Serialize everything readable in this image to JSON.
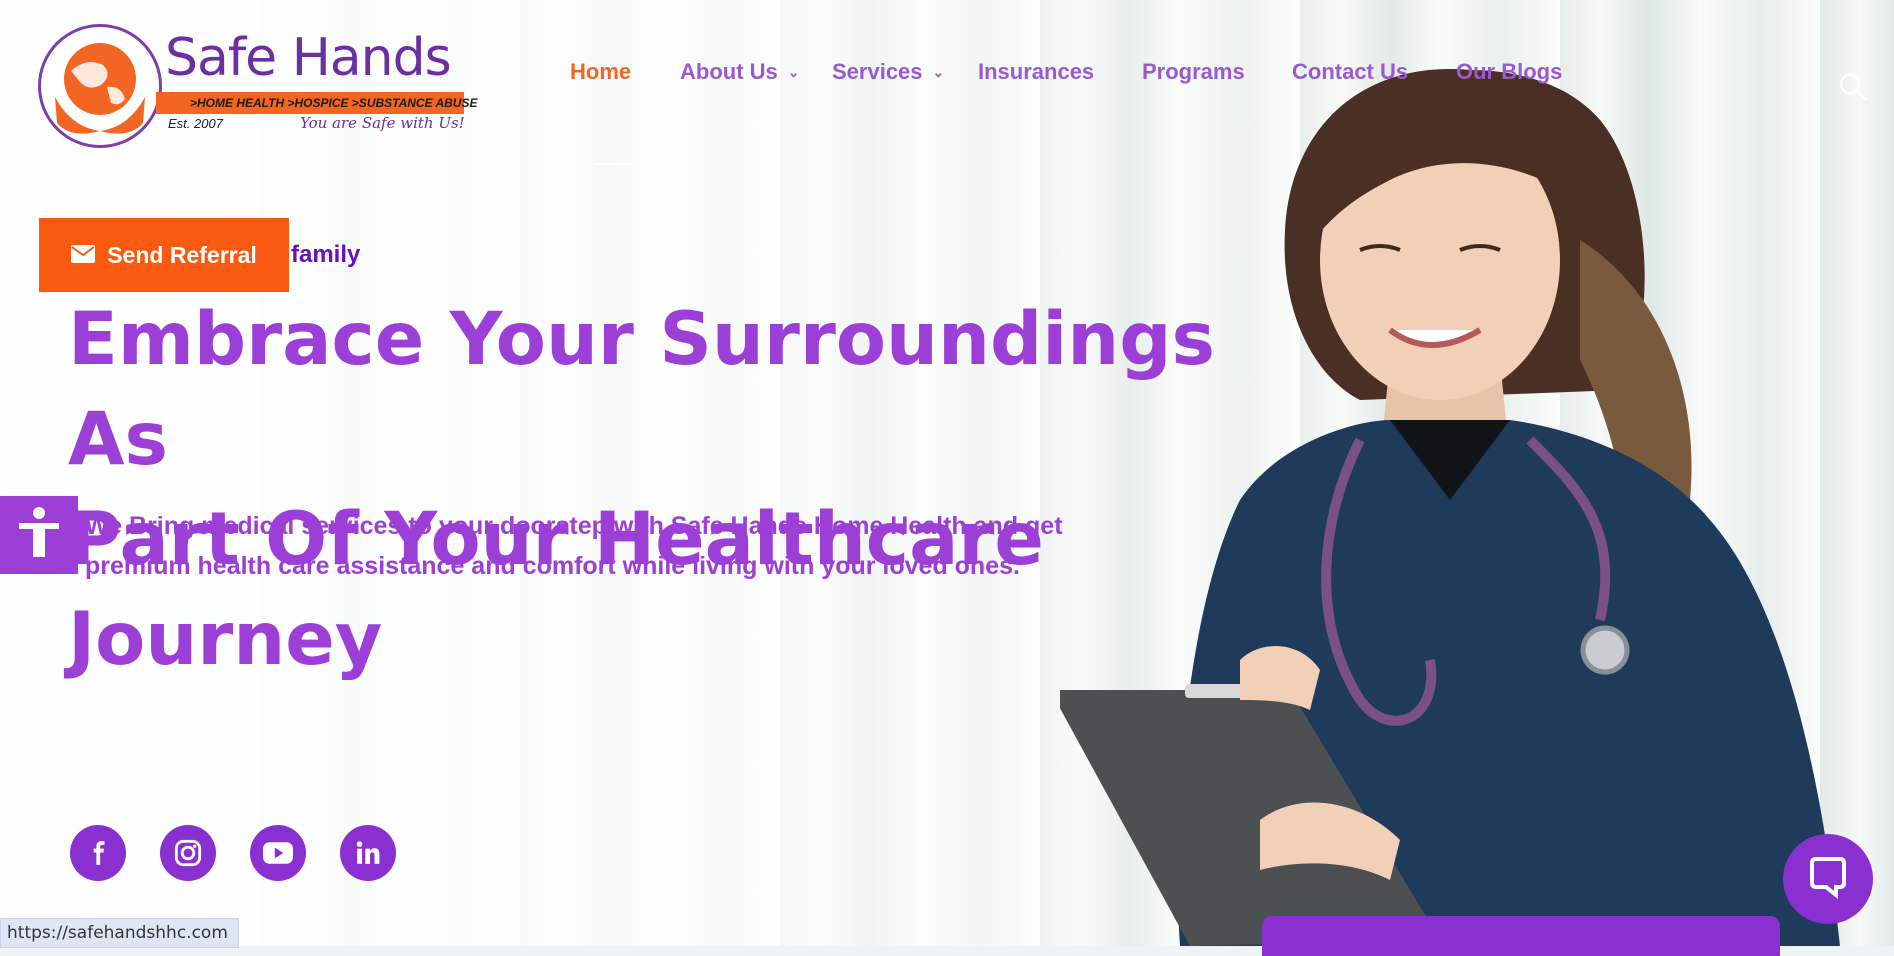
{
  "logo": {
    "title": "Safe Hands",
    "strip": ">HOME HEALTH >HOSPICE >SUBSTANCE ABUSE",
    "est": "Est. 2007",
    "tagline": "You are Safe with Us!"
  },
  "nav": {
    "items": [
      {
        "label": "Home",
        "active": true,
        "dropdown": false
      },
      {
        "label": "About Us",
        "active": false,
        "dropdown": true
      },
      {
        "label": "Services",
        "active": false,
        "dropdown": true
      },
      {
        "label": "Insurances",
        "active": false,
        "dropdown": false
      },
      {
        "label": "Programs",
        "active": false,
        "dropdown": false
      },
      {
        "label": "Contact Us",
        "active": false,
        "dropdown": false
      },
      {
        "label": "Our Blogs",
        "active": false,
        "dropdown": false
      }
    ],
    "search_icon": "search-icon"
  },
  "hero": {
    "referral_label": "Send Referral",
    "referral_icon": "envelope-icon",
    "eyebrow": "family",
    "headline_line1": "Embrace Your Surroundings As",
    "headline_line2": "Part Of Your Healthcare Journey",
    "subtext_line1": "We Bring medical services to your doorstep with Safe Hands Home Health and get",
    "subtext_line2": "premium health care assistance and comfort while living with your loved ones."
  },
  "socials": [
    {
      "name": "facebook-icon"
    },
    {
      "name": "instagram-icon"
    },
    {
      "name": "youtube-icon"
    },
    {
      "name": "linkedin-icon"
    }
  ],
  "status_bar": {
    "url": "https://safehandshhc.com"
  },
  "colors": {
    "brand_purple": "#9b3fd6",
    "accent_orange": "#fa5a0f",
    "nav_active": "#f26522"
  }
}
